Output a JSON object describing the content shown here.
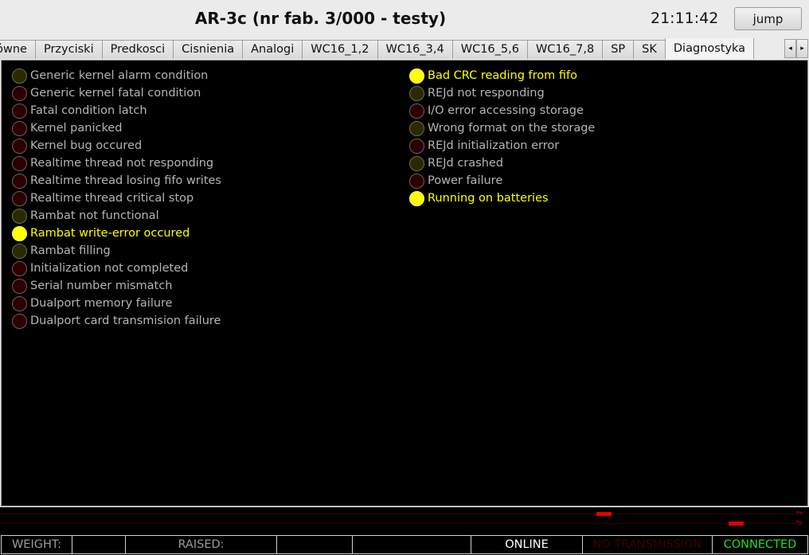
{
  "header": {
    "title": "AR-3c (nr fab. 3/000 - testy)",
    "clock": "21:11:42",
    "jump_label": "jump"
  },
  "tabs": [
    "łówne",
    "Przyciski",
    "Predkosci",
    "Cisnienia",
    "Analogi",
    "WC16_1,2",
    "WC16_3,4",
    "WC16_5,6",
    "WC16_7,8",
    "SP",
    "SK",
    "Diagnostyka"
  ],
  "active_tab": "Diagnostyka",
  "tab_scroll": {
    "left": "◂",
    "right": "▸"
  },
  "diagnostics": {
    "left": [
      {
        "label": "Generic kernel alarm condition",
        "state": "olive"
      },
      {
        "label": "Generic kernel fatal condition",
        "state": "red"
      },
      {
        "label": "Fatal condition latch",
        "state": "red"
      },
      {
        "label": "Kernel panicked",
        "state": "red"
      },
      {
        "label": "Kernel bug occured",
        "state": "red"
      },
      {
        "label": "Realtime thread not responding",
        "state": "red"
      },
      {
        "label": "Realtime thread losing fifo writes",
        "state": "red"
      },
      {
        "label": "Realtime thread critical stop",
        "state": "red"
      },
      {
        "label": "Rambat not functional",
        "state": "olive"
      },
      {
        "label": "Rambat write-error occured",
        "state": "yellow"
      },
      {
        "label": "Rambat filling",
        "state": "olive"
      },
      {
        "label": "Initialization not completed",
        "state": "red"
      },
      {
        "label": "Serial number mismatch",
        "state": "red"
      },
      {
        "label": "Dualport memory failure",
        "state": "red"
      },
      {
        "label": "Dualport card transmision failure",
        "state": "red"
      }
    ],
    "right": [
      {
        "label": "Bad CRC reading from fifo",
        "state": "yellow"
      },
      {
        "label": "REJd not responding",
        "state": "olive"
      },
      {
        "label": "I/O error accessing storage",
        "state": "red"
      },
      {
        "label": "Wrong format on the storage",
        "state": "olive"
      },
      {
        "label": "REJd initialization error",
        "state": "red"
      },
      {
        "label": "REJd crashed",
        "state": "olive"
      },
      {
        "label": "Power failure",
        "state": "red"
      },
      {
        "label": "Running on batteries",
        "state": "yellow"
      }
    ]
  },
  "graph": {
    "label_top": "Pw",
    "label_bottom": "Pp"
  },
  "status_bar": {
    "weight_label": "WEIGHT:",
    "weight_value": "",
    "raised_label": "RAISED:",
    "raised_value": "",
    "blank": "",
    "online": "ONLINE",
    "transmission": "NO TRANSMISSION",
    "connection": "CONNECTED",
    "colors": {
      "online": "#ffffff",
      "transmission": "#3a0000",
      "connection": "#22dd22",
      "label": "#9a9a9a"
    }
  }
}
